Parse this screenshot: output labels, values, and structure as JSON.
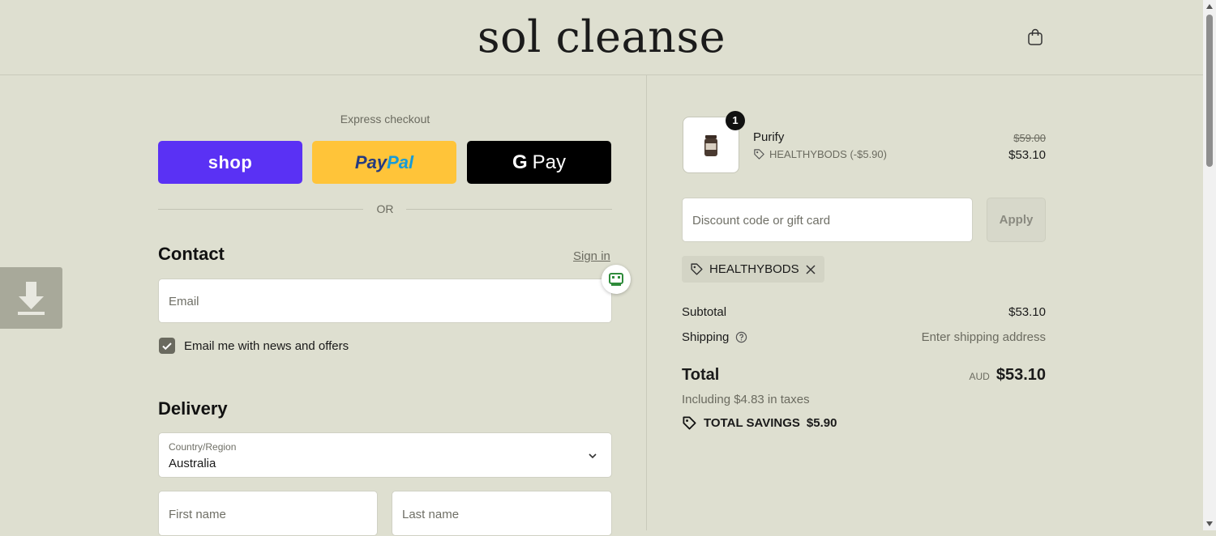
{
  "brand": "sol cleanse",
  "express": {
    "title": "Express checkout",
    "shop_label": "shop",
    "paypal_a": "Pay",
    "paypal_b": "Pal",
    "gpay_g": "G",
    "gpay_label": "Pay",
    "or_label": "OR"
  },
  "contact": {
    "heading": "Contact",
    "sign_in": "Sign in",
    "email_placeholder": "Email",
    "news_label": "Email me with news and offers",
    "news_checked": true
  },
  "delivery": {
    "heading": "Delivery",
    "country_label": "Country/Region",
    "country_value": "Australia",
    "first_name_placeholder": "First name",
    "last_name_placeholder": "Last name"
  },
  "cart": {
    "quantity": "1",
    "product_name": "Purify",
    "discount_line": "HEALTHYBODS (-$5.90)",
    "original_price": "$59.00",
    "price": "$53.10"
  },
  "discount": {
    "placeholder": "Discount code or gift card",
    "apply_label": "Apply",
    "applied_code": "HEALTHYBODS"
  },
  "summary": {
    "subtotal_label": "Subtotal",
    "subtotal_value": "$53.10",
    "shipping_label": "Shipping",
    "shipping_value": "Enter shipping address",
    "total_label": "Total",
    "currency": "AUD",
    "total_value": "$53.10",
    "tax_note": "Including $4.83 in taxes",
    "savings_label": "TOTAL SAVINGS",
    "savings_value": "$5.90"
  },
  "colors": {
    "background": "#dedfd0",
    "shop_pay": "#5a31f4",
    "paypal": "#ffc439",
    "gpay": "#000000"
  }
}
